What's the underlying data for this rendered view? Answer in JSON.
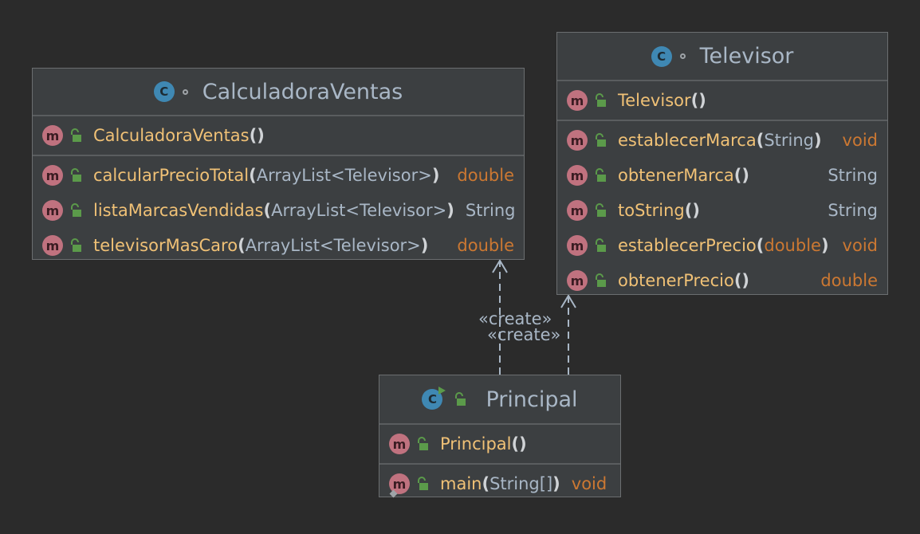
{
  "classes": {
    "calc": {
      "name": "CalculadoraVentas",
      "constructor": "CalculadoraVentas",
      "methods": [
        {
          "name": "calcularPrecioTotal",
          "param": "ArrayList<Televisor>",
          "ret": "double"
        },
        {
          "name": "listaMarcasVendidas",
          "param": "ArrayList<Televisor>",
          "ret": "String"
        },
        {
          "name": "televisorMasCaro",
          "param": "ArrayList<Televisor>",
          "ret": "double"
        }
      ]
    },
    "tv": {
      "name": "Televisor",
      "constructor": "Televisor",
      "methods": [
        {
          "name": "establecerMarca",
          "param": "String",
          "ret": "void"
        },
        {
          "name": "obtenerMarca",
          "param": "",
          "ret": "String"
        },
        {
          "name": "toString",
          "param": "",
          "ret": "String"
        },
        {
          "name": "establecerPrecio",
          "param": "double",
          "ret": "void"
        },
        {
          "name": "obtenerPrecio",
          "param": "",
          "ret": "double"
        }
      ]
    },
    "main": {
      "name": "Principal",
      "constructor": "Principal",
      "methods": [
        {
          "name": "main",
          "param": "String[]",
          "ret": "void"
        }
      ]
    }
  },
  "relations": {
    "create1": "«create»",
    "create2": "«create»"
  },
  "icons": {
    "class": "C",
    "method": "m"
  },
  "colors": {
    "background": "#2b2b2b",
    "box": "#3c3f41",
    "method_name": "#f0c176",
    "return_keyword": "#cc7832",
    "class_icon": "#3f88b3",
    "method_icon": "#c0727f",
    "lock": "#5b9a4a"
  }
}
